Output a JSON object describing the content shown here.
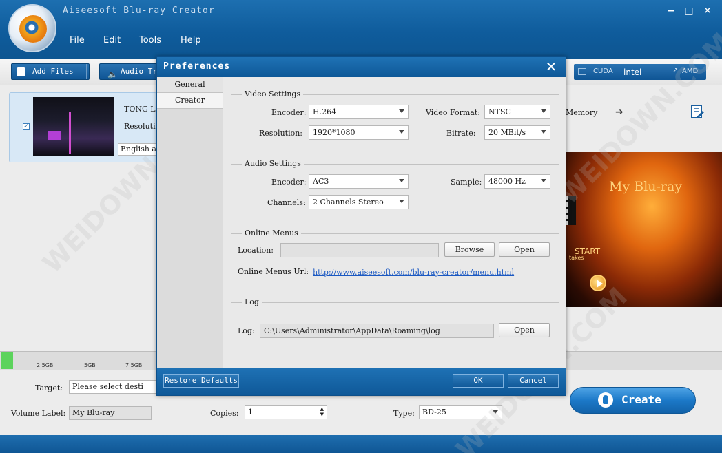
{
  "app": {
    "title": "Aiseesoft Blu-ray Creator"
  },
  "menu": [
    "File",
    "Edit",
    "Tools",
    "Help"
  ],
  "window_controls": {
    "minimize": "−",
    "maximize": "□",
    "close": "✕"
  },
  "toolbar": {
    "add_files": "Add Files",
    "dropdown_arrow": "▾",
    "audio_track": "Audio Track"
  },
  "accel": [
    "CUDA",
    "intel",
    "AMD"
  ],
  "file_item": {
    "name": "TONG LIY",
    "resolution": "Resolutio",
    "language": "English a",
    "checkbox": "✓"
  },
  "preview": {
    "memory_label": "Memory",
    "arrow": "➔",
    "menu_title": "My Blu-ray",
    "menu_start": "START",
    "menu_takes": "takes"
  },
  "capacity": {
    "ticks": [
      "2.5GB",
      "5GB",
      "7.5GB"
    ],
    "used_fraction": 0.02
  },
  "bottom": {
    "target_label": "Target:",
    "target_value": "Please select desti",
    "volume_label": "Volume Label:",
    "volume_value": "My Blu-ray",
    "copies_label": "Copies:",
    "copies_value": "1",
    "type_label": "Type:",
    "type_value": "BD-25",
    "create": "Create"
  },
  "watermark": "WEIDOWN.COM",
  "dialog": {
    "title": "Preferences",
    "close": "✕",
    "nav": [
      "General",
      "Creator"
    ],
    "video": {
      "section": "Video Settings",
      "encoder_label": "Encoder:",
      "encoder": "H.264",
      "format_label": "Video Format:",
      "format": "NTSC",
      "resolution_label": "Resolution:",
      "resolution": "1920*1080",
      "bitrate_label": "Bitrate:",
      "bitrate": "20 MBit/s"
    },
    "audio": {
      "section": "Audio Settings",
      "encoder_label": "Encoder:",
      "encoder": "AC3",
      "sample_label": "Sample:",
      "sample": "48000 Hz",
      "channels_label": "Channels:",
      "channels": "2 Channels Stereo"
    },
    "online": {
      "section": "Online Menus",
      "location_label": "Location:",
      "location_value": "",
      "browse": "Browse",
      "open": "Open",
      "url_label": "Online Menus Url:",
      "url": "http://www.aiseesoft.com/blu-ray-creator/menu.html"
    },
    "log": {
      "section": "Log",
      "label": "Log:",
      "path": "C:\\Users\\Administrator\\AppData\\Roaming\\log",
      "open": "Open"
    },
    "footer": {
      "restore": "Restore Defaults",
      "ok": "OK",
      "cancel": "Cancel"
    }
  }
}
